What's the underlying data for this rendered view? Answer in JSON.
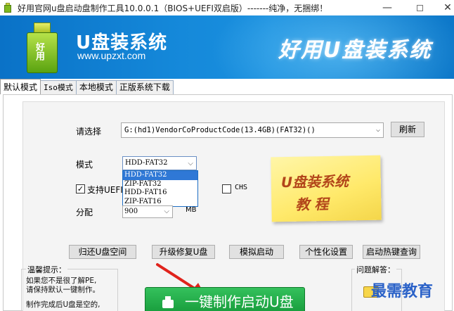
{
  "window": {
    "title": "好用官网u盘启动盘制作工具10.0.0.1（BIOS+UEFI双启版）-------纯净，无捆绑！",
    "min_glyph": "—",
    "close_glyph": "✕"
  },
  "banner": {
    "logo_text": "好用",
    "brand_name": "U盘装系统",
    "brand_url": "www.upzxt.com",
    "slogan": "好用U盘装系统"
  },
  "tabs": [
    {
      "label": "默认模式",
      "active": true
    },
    {
      "label": "Iso模式",
      "active": false
    },
    {
      "label": "本地模式",
      "active": false
    },
    {
      "label": "正版系统下载",
      "active": false
    }
  ],
  "form": {
    "select_label": "请选择",
    "drive_value": "G:(hd1)VendorCoProductCode(13.4GB)(FAT32)()",
    "refresh_label": "刷新",
    "mode_label": "模式",
    "mode_value": "HDD-FAT32",
    "mode_options": [
      "HDD-FAT32",
      "ZIP-FAT32",
      "HDD-FAT16",
      "ZIP-FAT16"
    ],
    "mode_selected_index": 0,
    "uefi_label": "支持UEFI",
    "uefi_checked": true,
    "chs_label": "CHS",
    "chs_checked": false,
    "alloc_label": "分配",
    "alloc_value": "900",
    "alloc_unit": "MB",
    "check_glyph": "✓",
    "arrow_glyph": "⌵"
  },
  "note": {
    "line1": "U盘装系统",
    "line2": "教 程"
  },
  "actions": {
    "restore": "归还U盘空间",
    "upgrade": "升级修复U盘",
    "simulate": "模拟启动",
    "personalize": "个性化设置",
    "hotkey": "启动热键查询"
  },
  "tips": {
    "legend": "温馨提示：",
    "line1": "如果您不是很了解PE,",
    "line2": "请保持默认一键制作。",
    "line3": "制作完成后U盘是空的,"
  },
  "faq": {
    "legend": "问题解答："
  },
  "main_button": {
    "label": "一键制作启动U盘"
  },
  "watermark": "最需教育"
}
